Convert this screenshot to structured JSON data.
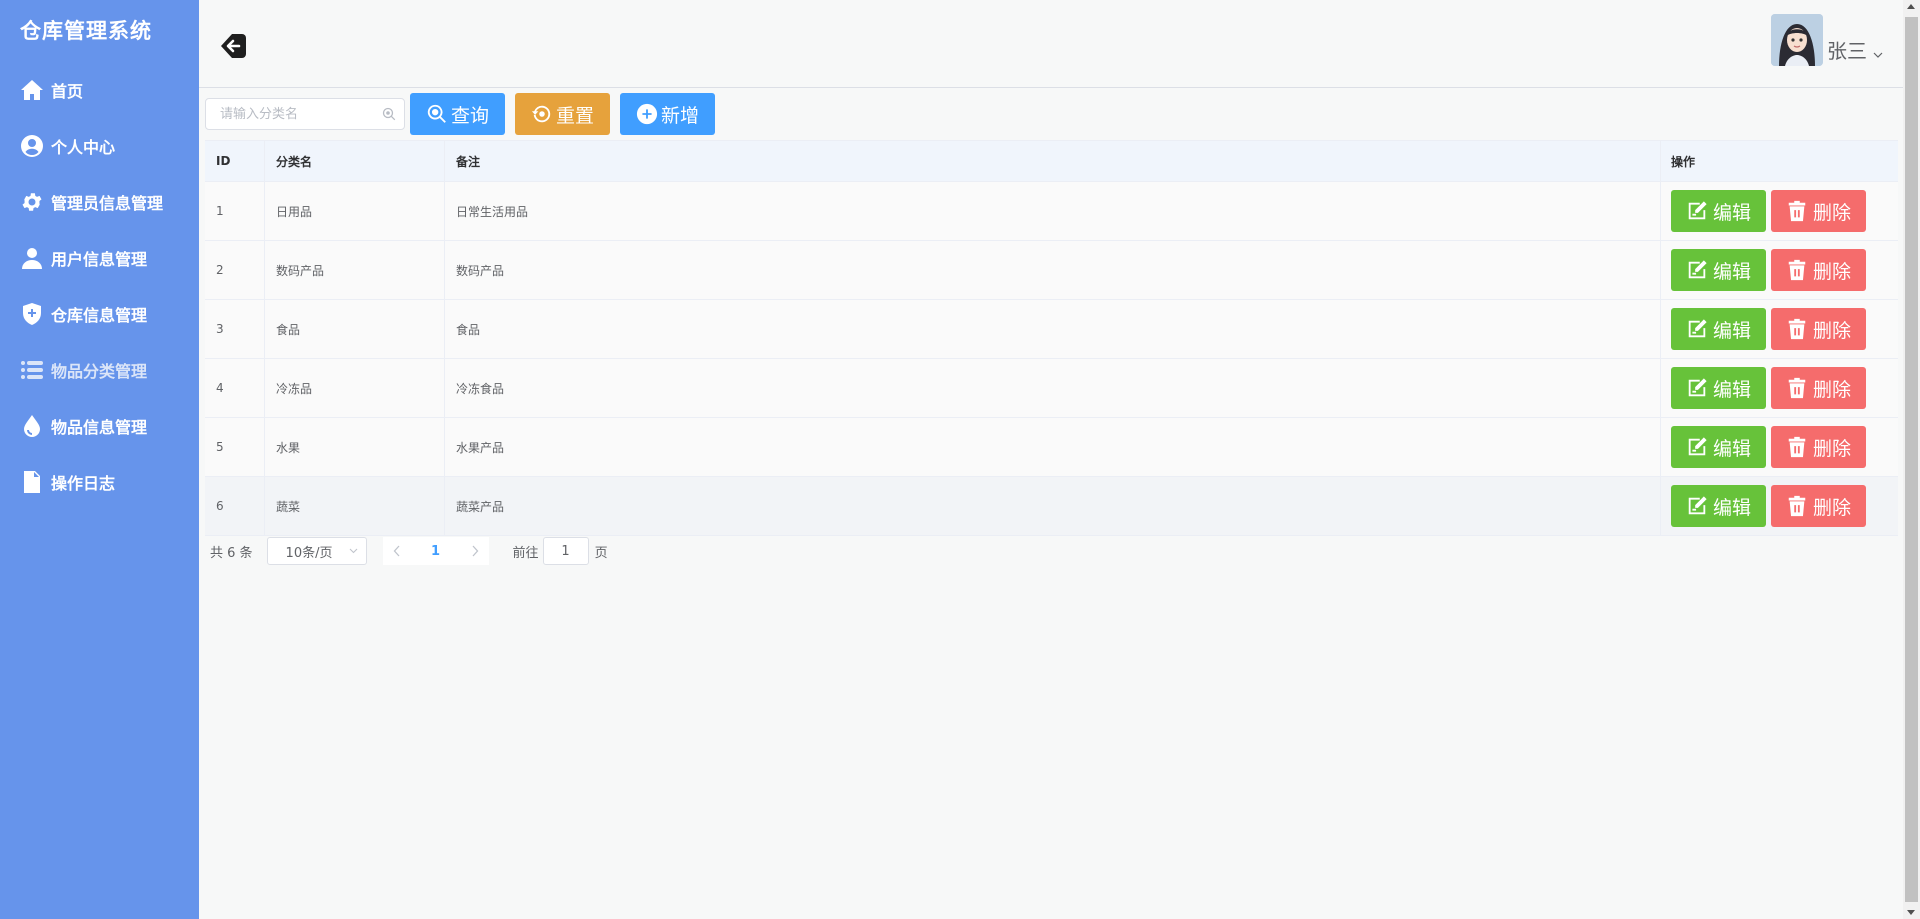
{
  "app": {
    "title": "仓库管理系统"
  },
  "sidebar": {
    "items": [
      {
        "label": "首页",
        "icon": "home-icon"
      },
      {
        "label": "个人中心",
        "icon": "user-center-icon"
      },
      {
        "label": "管理员信息管理",
        "icon": "gear-icon"
      },
      {
        "label": "用户信息管理",
        "icon": "user-icon"
      },
      {
        "label": "仓库信息管理",
        "icon": "warehouse-icon"
      },
      {
        "label": "物品分类管理",
        "icon": "list-icon",
        "active": true
      },
      {
        "label": "物品信息管理",
        "icon": "drop-icon"
      },
      {
        "label": "操作日志",
        "icon": "document-icon"
      }
    ]
  },
  "header": {
    "username": "张三"
  },
  "toolbar": {
    "search_placeholder": "请输入分类名",
    "query_label": "查询",
    "reset_label": "重置",
    "add_label": "新增"
  },
  "table": {
    "columns": [
      "ID",
      "分类名",
      "备注",
      "操作"
    ],
    "edit_label": "编辑",
    "delete_label": "删除",
    "rows": [
      {
        "id": "1",
        "name": "日用品",
        "note": "日常生活用品"
      },
      {
        "id": "2",
        "name": "数码产品",
        "note": "数码产品"
      },
      {
        "id": "3",
        "name": "食品",
        "note": "食品"
      },
      {
        "id": "4",
        "name": "冷冻品",
        "note": "冷冻食品"
      },
      {
        "id": "5",
        "name": "水果",
        "note": "水果产品"
      },
      {
        "id": "6",
        "name": "蔬菜",
        "note": "蔬菜产品"
      }
    ]
  },
  "pagination": {
    "total_text": "共 6 条",
    "page_size": "10条/页",
    "current_page": "1",
    "goto_label": "前往",
    "goto_value": "1",
    "page_unit": "页"
  },
  "colors": {
    "sidebar": "#6694eb",
    "primary": "#409eff",
    "warning": "#e6a23c",
    "success": "#67c23a",
    "danger": "#f56c6c"
  }
}
